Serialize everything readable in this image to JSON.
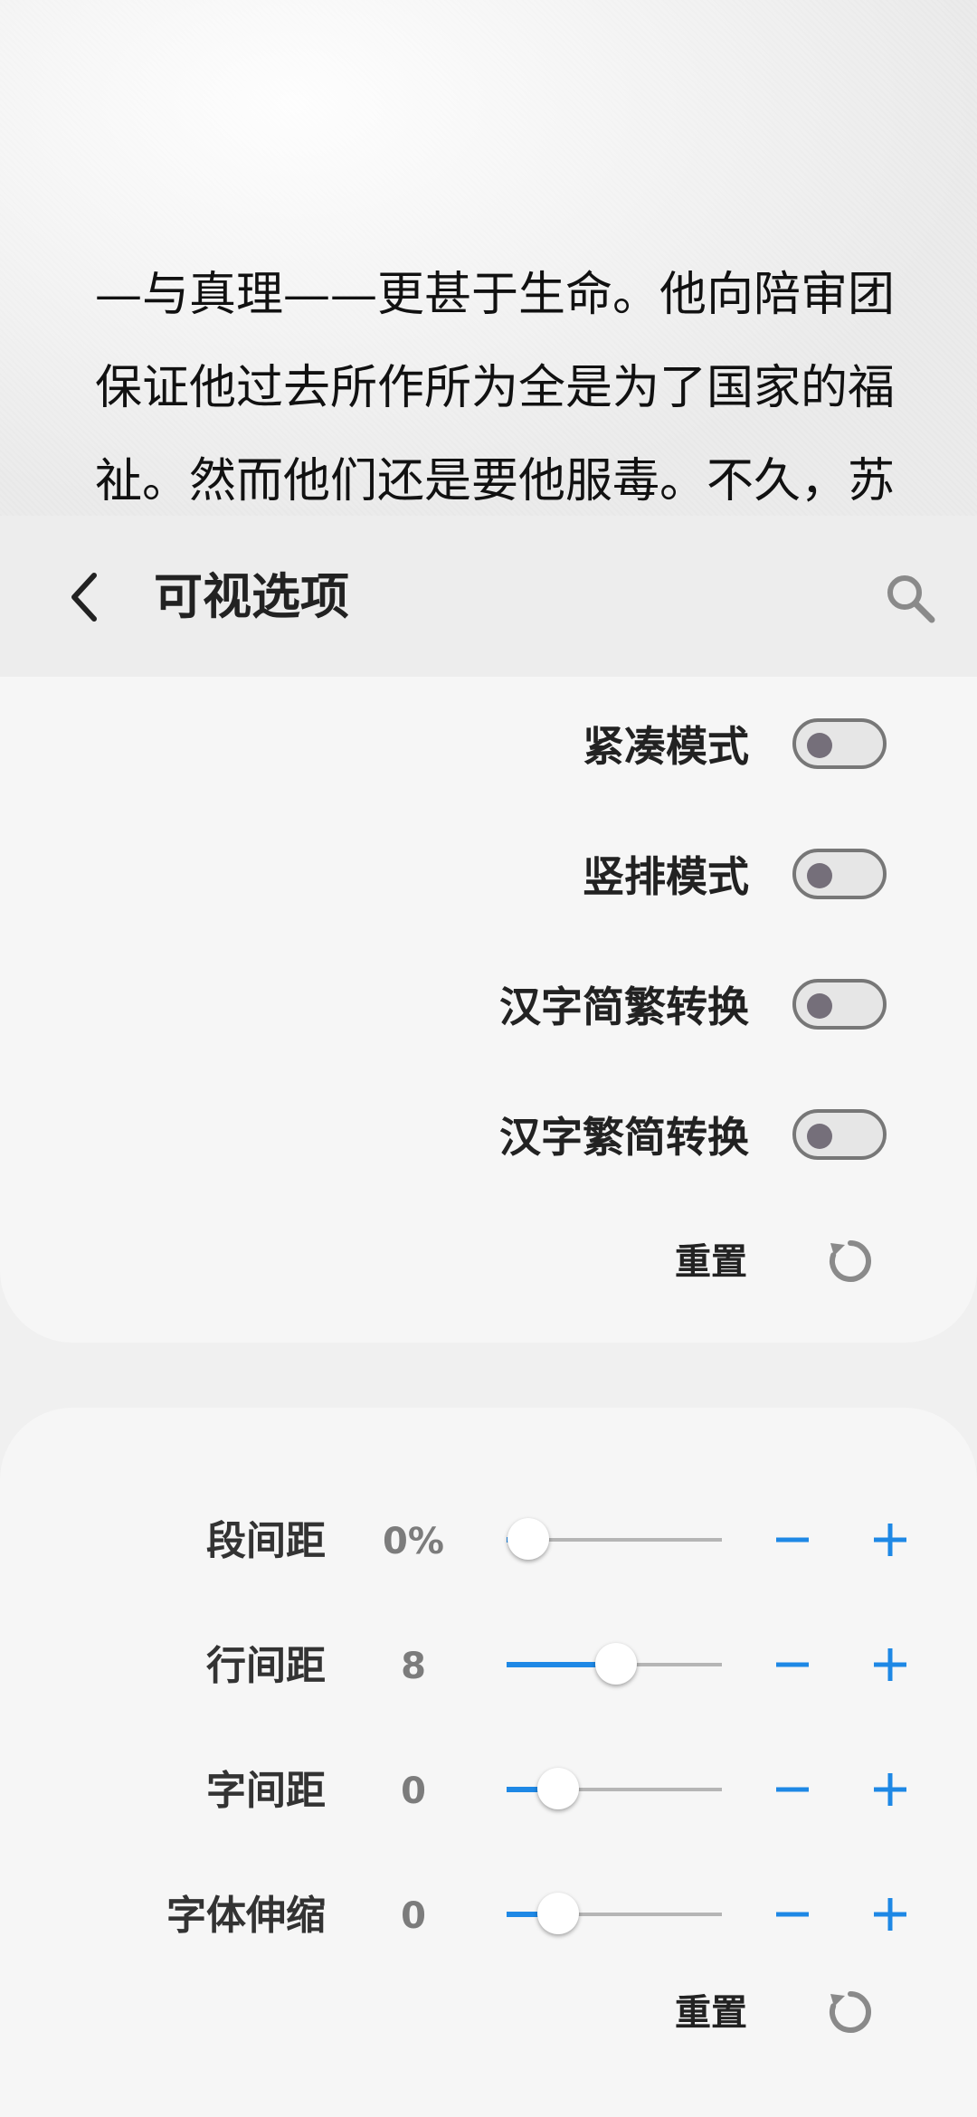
{
  "reader": {
    "lines": [
      "—与真理——更甚于生命。他向陪审团",
      "保证他过去所作所为全是为了国家的福",
      "祉。然而他们还是要他服毒。不久，苏"
    ]
  },
  "header": {
    "title": "可视选项",
    "back_icon": "chevron-left-icon",
    "search_icon": "search-icon"
  },
  "toggles": [
    {
      "label": "紧凑模式",
      "on": false
    },
    {
      "label": "竖排模式",
      "on": false
    },
    {
      "label": "汉字简繁转换",
      "on": false
    },
    {
      "label": "汉字繁简转换",
      "on": false
    }
  ],
  "reset_label_1": "重置",
  "sliders": [
    {
      "label": "段间距",
      "value": "0%",
      "fraction": 0.1
    },
    {
      "label": "行间距",
      "value": "8",
      "fraction": 0.51
    },
    {
      "label": "字间距",
      "value": "0",
      "fraction": 0.24
    },
    {
      "label": "字体伸缩",
      "value": "0",
      "fraction": 0.24
    }
  ],
  "reset_label_2": "重置",
  "colors": {
    "accent": "#1e88e5",
    "toggle_off_knob": "#756f7a",
    "header_bg": "#ededed",
    "card_bg": "#f6f6f6"
  }
}
